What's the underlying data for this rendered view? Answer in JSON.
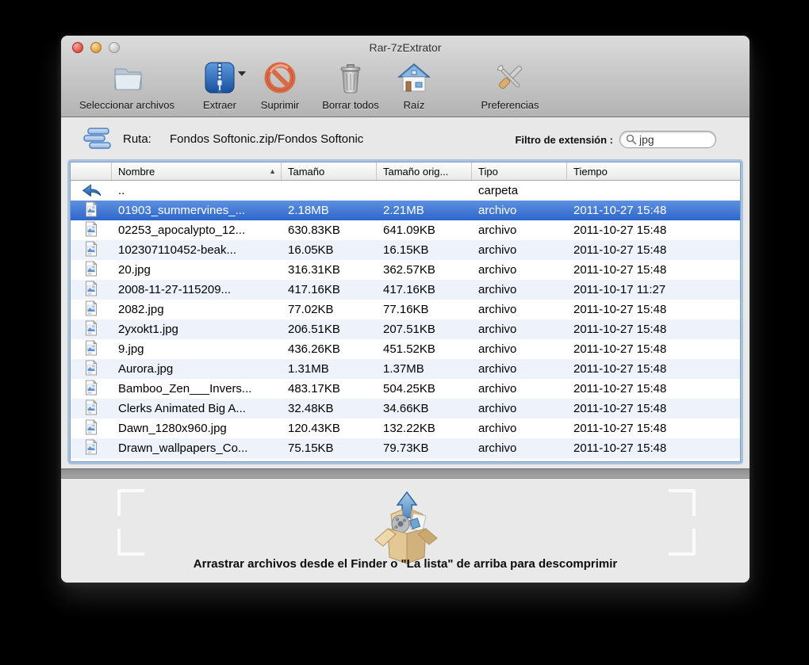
{
  "window": {
    "title": "Rar-7zExtrator"
  },
  "toolbar": {
    "items": [
      {
        "label": "Seleccionar archivos",
        "icon": "folder-icon"
      },
      {
        "label": "Extraer",
        "icon": "zip-archive-icon",
        "has_dropdown": true
      },
      {
        "label": "Suprimir",
        "icon": "prohibited-icon"
      },
      {
        "label": "Borrar todos",
        "icon": "trash-icon"
      },
      {
        "label": "Raíz",
        "icon": "home-icon"
      },
      {
        "label": "Preferencias",
        "icon": "tools-icon"
      }
    ]
  },
  "path_bar": {
    "label": "Ruta:",
    "path": "Fondos Softonic.zip/Fondos Softonic",
    "filter_label": "Filtro de extensión :",
    "filter_value": "jpg"
  },
  "table": {
    "columns": [
      "",
      "Nombre",
      "Tamaño",
      "Tamaño orig...",
      "Tipo",
      "Tiempo"
    ],
    "sort_column": "Nombre",
    "sort_ascending": true,
    "rows": [
      {
        "icon": "back-arrow-icon",
        "name": "..",
        "size": "",
        "orig_size": "",
        "type": "carpeta",
        "time": "",
        "selected": false
      },
      {
        "icon": "jpg-file-icon",
        "name": "01903_summervines_...",
        "size": "2.18MB",
        "orig_size": "2.21MB",
        "type": "archivo",
        "time": "2011-10-27 15:48",
        "selected": true
      },
      {
        "icon": "jpg-file-icon",
        "name": "02253_apocalypto_12...",
        "size": "630.83KB",
        "orig_size": "641.09KB",
        "type": "archivo",
        "time": "2011-10-27 15:48",
        "selected": false
      },
      {
        "icon": "jpg-file-icon",
        "name": "102307110452-beak...",
        "size": "16.05KB",
        "orig_size": "16.15KB",
        "type": "archivo",
        "time": "2011-10-27 15:48",
        "selected": false
      },
      {
        "icon": "jpg-file-icon",
        "name": "20.jpg",
        "size": "316.31KB",
        "orig_size": "362.57KB",
        "type": "archivo",
        "time": "2011-10-27 15:48",
        "selected": false
      },
      {
        "icon": "jpg-file-icon",
        "name": "2008-11-27-115209...",
        "size": "417.16KB",
        "orig_size": "417.16KB",
        "type": "archivo",
        "time": "2011-10-17 11:27",
        "selected": false
      },
      {
        "icon": "jpg-file-icon",
        "name": "2082.jpg",
        "size": "77.02KB",
        "orig_size": "77.16KB",
        "type": "archivo",
        "time": "2011-10-27 15:48",
        "selected": false
      },
      {
        "icon": "jpg-file-icon",
        "name": "2yxokt1.jpg",
        "size": "206.51KB",
        "orig_size": "207.51KB",
        "type": "archivo",
        "time": "2011-10-27 15:48",
        "selected": false
      },
      {
        "icon": "jpg-file-icon",
        "name": "9.jpg",
        "size": "436.26KB",
        "orig_size": "451.52KB",
        "type": "archivo",
        "time": "2011-10-27 15:48",
        "selected": false
      },
      {
        "icon": "jpg-file-icon",
        "name": "Aurora.jpg",
        "size": "1.31MB",
        "orig_size": "1.37MB",
        "type": "archivo",
        "time": "2011-10-27 15:48",
        "selected": false
      },
      {
        "icon": "jpg-file-icon",
        "name": "Bamboo_Zen___Invers...",
        "size": "483.17KB",
        "orig_size": "504.25KB",
        "type": "archivo",
        "time": "2011-10-27 15:48",
        "selected": false
      },
      {
        "icon": "jpg-file-icon",
        "name": "Clerks Animated Big A...",
        "size": "32.48KB",
        "orig_size": "34.66KB",
        "type": "archivo",
        "time": "2011-10-27 15:48",
        "selected": false
      },
      {
        "icon": "jpg-file-icon",
        "name": "Dawn_1280x960.jpg",
        "size": "120.43KB",
        "orig_size": "132.22KB",
        "type": "archivo",
        "time": "2011-10-27 15:48",
        "selected": false
      },
      {
        "icon": "jpg-file-icon",
        "name": "Drawn_wallpapers_Co...",
        "size": "75.15KB",
        "orig_size": "79.73KB",
        "type": "archivo",
        "time": "2011-10-27 15:48",
        "selected": false
      }
    ]
  },
  "dropzone": {
    "caption": "Arrastrar archivos desde el Finder o \"La lista\" de arriba para descomprimir"
  },
  "colors": {
    "selection_top": "#5e91e0",
    "selection_bottom": "#2e66cc",
    "alt_row": "#eef3fb",
    "focus_ring": "#73a0d7",
    "chrome_top": "#dcdcdc",
    "chrome_bottom": "#b3b3b3"
  }
}
